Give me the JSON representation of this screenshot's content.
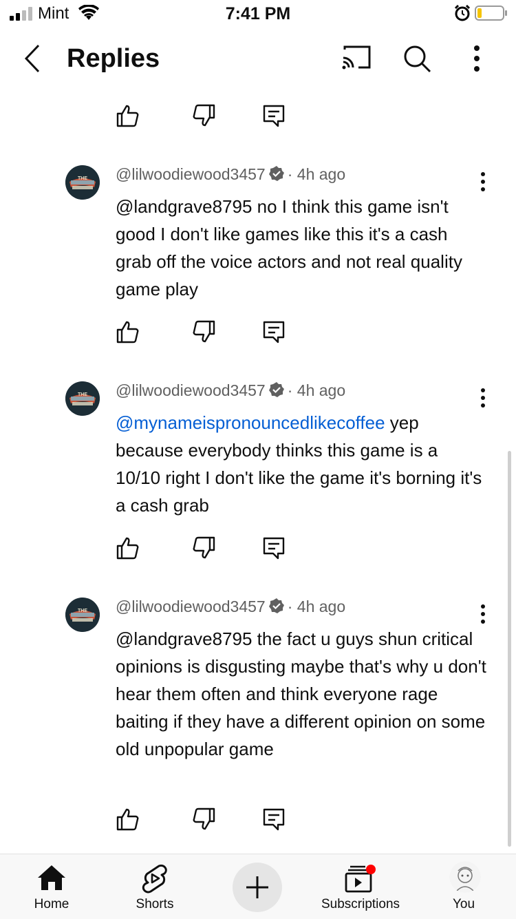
{
  "status_bar": {
    "carrier": "Mint",
    "time": "7:41 PM",
    "battery_color": "#f5c400"
  },
  "header": {
    "title": "Replies",
    "icons": [
      "back-icon",
      "cast-icon",
      "search-icon",
      "more-vert-icon"
    ]
  },
  "comments": [
    {
      "author": "@lilwoodiewood3457",
      "time": "4h ago",
      "mention": "",
      "text": "@landgrave8795  no I think this game isn't good I don't like games like this it's a cash grab off the voice actors and not real quality game play"
    },
    {
      "author": "@lilwoodiewood3457",
      "time": "4h ago",
      "mention": "@mynameispronouncedlikecoffee",
      "text": " yep because everybody thinks this game is a 10/10 right I don't like the game it's borning it's a cash grab"
    },
    {
      "author": "@lilwoodiewood3457",
      "time": "4h ago",
      "mention": "",
      "text": "@landgrave8795 the fact u guys shun critical opinions is disgusting maybe that's why u don't hear them often and think everyone rage baiting if they have a different opinion on some old unpopular game"
    }
  ],
  "bottom_nav": {
    "home": "Home",
    "shorts": "Shorts",
    "subscriptions": "Subscriptions",
    "you": "You",
    "notification_dot_color": "#ff0000"
  },
  "colors": {
    "mention": "#065fd4",
    "meta": "#606060",
    "text": "#0f0f0f"
  }
}
